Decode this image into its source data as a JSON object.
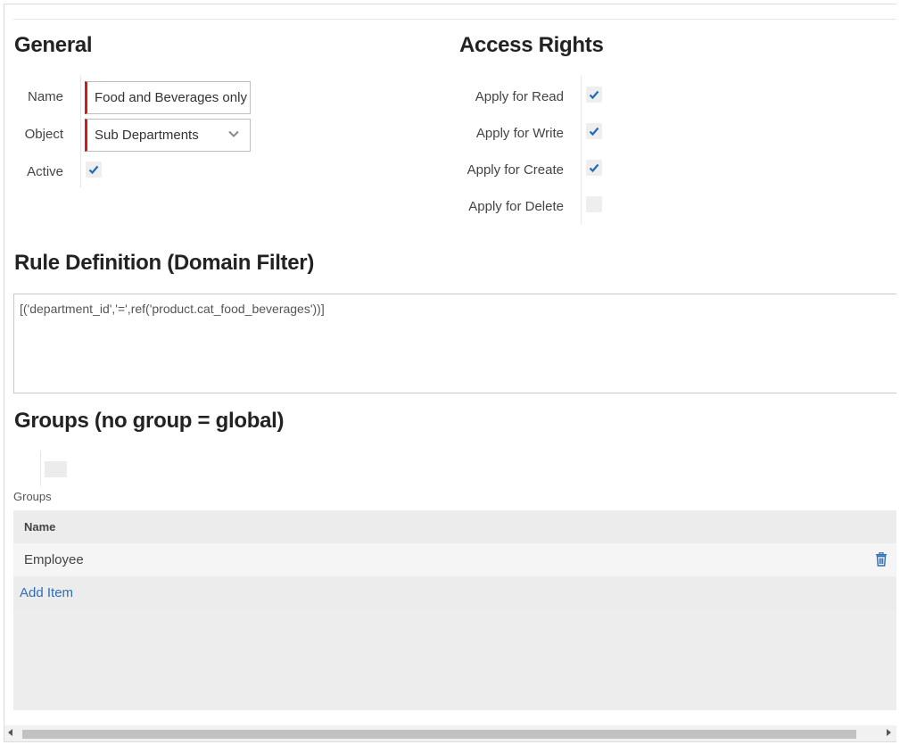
{
  "general": {
    "title": "General",
    "name_label": "Name",
    "name_value": "Food and Beverages only",
    "object_label": "Object",
    "object_value": "Sub Departments",
    "active_label": "Active",
    "active_checked": true
  },
  "access_rights": {
    "title": "Access Rights",
    "items": [
      {
        "label": "Apply for Read",
        "checked": true
      },
      {
        "label": "Apply for Write",
        "checked": true
      },
      {
        "label": "Apply for Create",
        "checked": true
      },
      {
        "label": "Apply for Delete",
        "checked": false
      }
    ]
  },
  "rule": {
    "title": "Rule Definition (Domain Filter)",
    "domain": "[('department_id','=',ref('product.cat_food_beverages'))]"
  },
  "groups": {
    "title": "Groups (no group = global)",
    "field_label": "Groups",
    "column_name": "Name",
    "rows": [
      {
        "name": "Employee"
      }
    ],
    "add_item_label": "Add Item"
  },
  "colors": {
    "required_border": "#d01a1a",
    "check": "#1e6bb8",
    "link": "#2e6fb5"
  },
  "icons": {
    "check": "check-icon",
    "chevron": "chevron-down-icon",
    "trash": "trash-icon"
  }
}
